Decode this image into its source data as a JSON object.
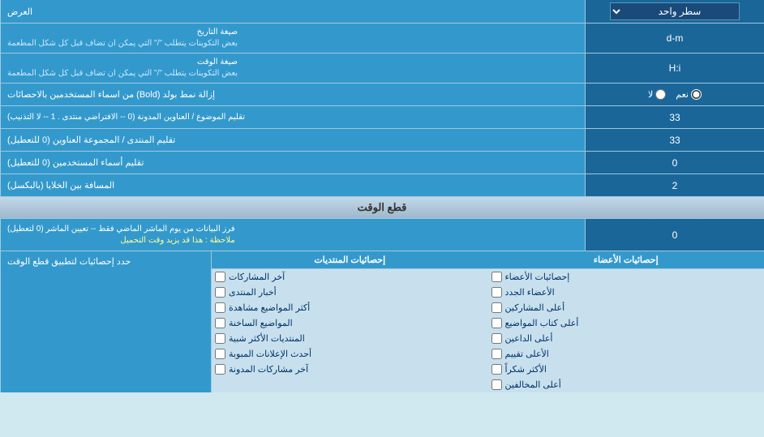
{
  "page": {
    "title": "العرض",
    "sections": {
      "display": {
        "label": "العرض"
      },
      "time_cut": {
        "label": "قطع الوقت"
      }
    },
    "rows": [
      {
        "id": "single_line",
        "label": "العرض",
        "input_type": "select",
        "value": "سطر واحد"
      },
      {
        "id": "date_format",
        "label": "صيغة التاريخ\nبعض التكوينات يتطلب \"/\" التي يمكن ان تضاف قبل كل شكل المطعمة",
        "input_type": "text",
        "value": "d-m"
      },
      {
        "id": "time_format",
        "label": "صيغة الوقت\nبعض التكوينات يتطلب \"/\" التي يمكن ان تضاف قبل كل شكل المطعمة",
        "input_type": "text",
        "value": "H:i"
      },
      {
        "id": "bold_remove",
        "label": "إزالة نمط بولد (Bold) من اسماء المستخدمين بالاحصائات",
        "input_type": "radio",
        "options": [
          "نعم",
          "لا"
        ],
        "selected": "نعم"
      },
      {
        "id": "topics_order",
        "label": "تقليم الموضوع / العناوين المدونة (0 -- الافتراضي منتدى . 1 -- لا التذنيب)",
        "input_type": "text",
        "value": "33"
      },
      {
        "id": "forum_trim",
        "label": "تقليم المنتدى / المجموعة العناوين (0 للتعطيل)",
        "input_type": "text",
        "value": "33"
      },
      {
        "id": "user_names",
        "label": "تقليم أسماء المستخدمين (0 للتعطيل)",
        "input_type": "text",
        "value": "0"
      },
      {
        "id": "cell_spacing",
        "label": "المسافة بين الخلايا (بالبكسل)",
        "input_type": "text",
        "value": "2"
      }
    ],
    "time_cut_rows": [
      {
        "id": "filter_data",
        "label_line1": "فرز البيانات من يوم الماشر الماضي فقط -- تعيين الماشر (0 لتعطيل)",
        "label_line2": "ملاحظة : هذا قد يزيد وقت التحميل",
        "input_type": "text",
        "value": "0"
      }
    ],
    "stats_section": {
      "label": "حدد إحصائيات لتطبيق قطع الوقت",
      "col1_header": "إحصائيات المنتديات",
      "col2_header": "إحصائيات الأعضاء",
      "col1_items": [
        "آخر المشاركات",
        "أخبار المنتدى",
        "أكثر المواضيع مشاهدة",
        "المواضيع الساخنة",
        "المنتديات الأكثر شبية",
        "أحدث الإعلانات المبوبة",
        "آخر مشاركات المدونة"
      ],
      "col2_items": [
        "إحصائيات الأعضاء",
        "الأعضاء الجدد",
        "أعلى المشاركين",
        "أعلى كتاب المواضيع",
        "أعلى الداعين",
        "الأعلى تقييم",
        "الأكثر شكراً",
        "أعلى المخالفين"
      ]
    }
  }
}
